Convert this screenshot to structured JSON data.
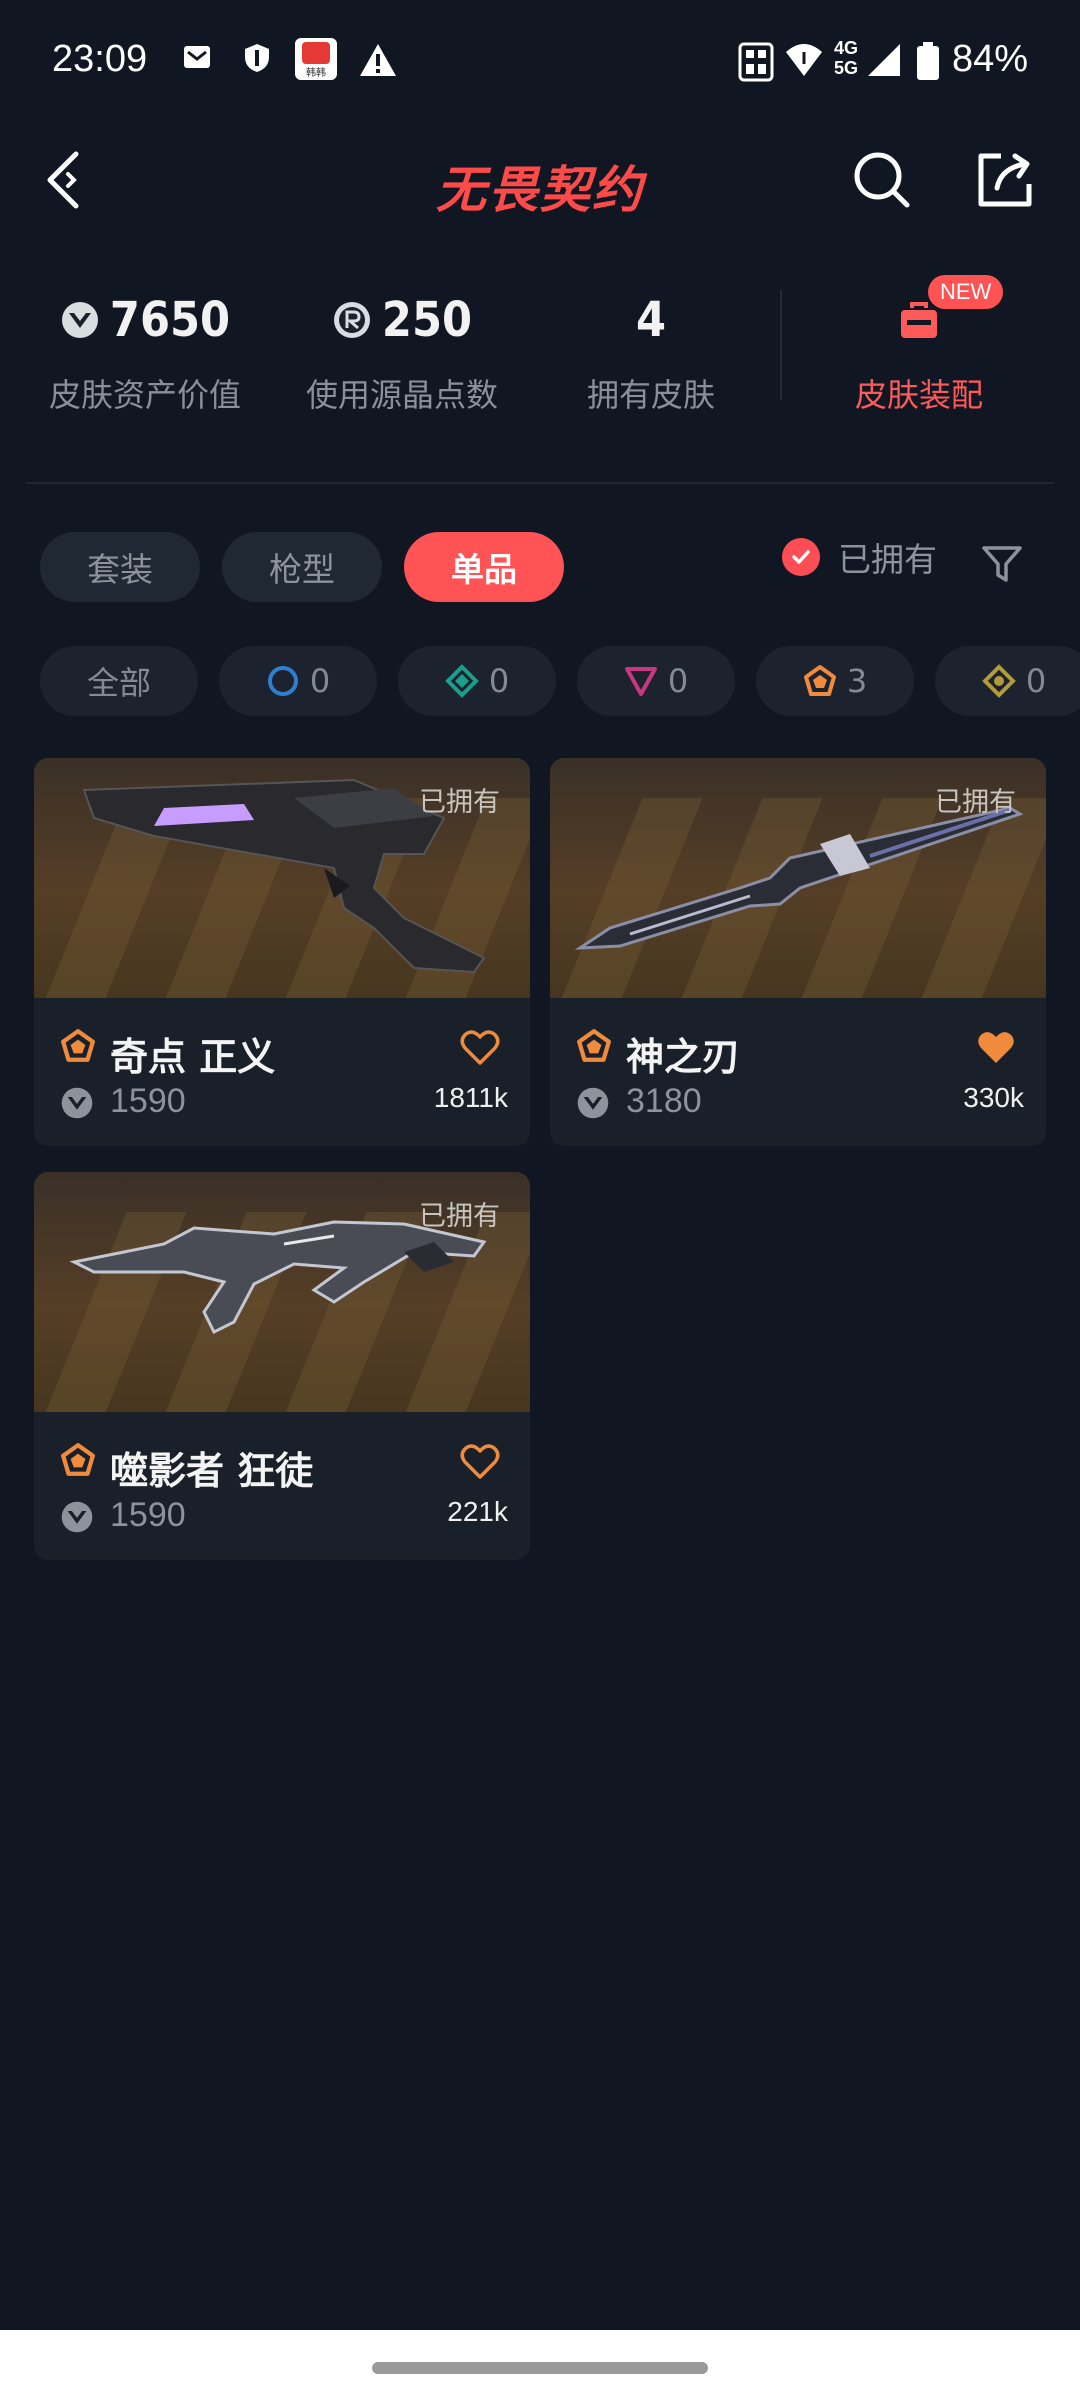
{
  "status_bar": {
    "time": "23:09",
    "network_top": "4G",
    "network_bottom": "5G",
    "battery": "84%",
    "app_badge": "韩韩"
  },
  "header": {
    "title": "无畏契约"
  },
  "stats": {
    "asset_value": "7650",
    "asset_value_label": "皮肤资产价值",
    "radianite_points": "250",
    "radianite_points_label": "使用源晶点数",
    "owned_count": "4",
    "owned_count_label": "拥有皮肤",
    "equip_label": "皮肤装配",
    "new_badge": "NEW"
  },
  "tabs": [
    {
      "label": "套装",
      "active": false
    },
    {
      "label": "枪型",
      "active": false
    },
    {
      "label": "单品",
      "active": true
    }
  ],
  "owned_filter_label": "已拥有",
  "rarity_filters": [
    {
      "label": "全部",
      "icon": "all",
      "count": ""
    },
    {
      "label": "",
      "icon": "ring-icon",
      "count": "0",
      "color": "#2f7fd0"
    },
    {
      "label": "",
      "icon": "diamond-icon",
      "count": "0",
      "color": "#1c9e8c"
    },
    {
      "label": "",
      "icon": "triangle-icon",
      "count": "0",
      "color": "#c8377f"
    },
    {
      "label": "",
      "icon": "pentagon-icon",
      "count": "3",
      "color": "#f08a3c"
    },
    {
      "label": "",
      "icon": "rhombus-icon",
      "count": "0",
      "color": "#b39a3a"
    }
  ],
  "cards": [
    {
      "owned_tag": "已拥有",
      "name": "奇点 正义",
      "price": "1590",
      "likes": "1811k",
      "favorited": false
    },
    {
      "owned_tag": "已拥有",
      "name": "神之刃",
      "price": "3180",
      "likes": "330k",
      "favorited": true
    },
    {
      "owned_tag": "已拥有",
      "name": "噬影者 狂徒",
      "price": "1590",
      "likes": "221k",
      "favorited": false
    }
  ],
  "colors": {
    "background": "#111722",
    "accent": "#ff5355",
    "card": "#192029",
    "rarity_orange": "#f08a3c"
  }
}
